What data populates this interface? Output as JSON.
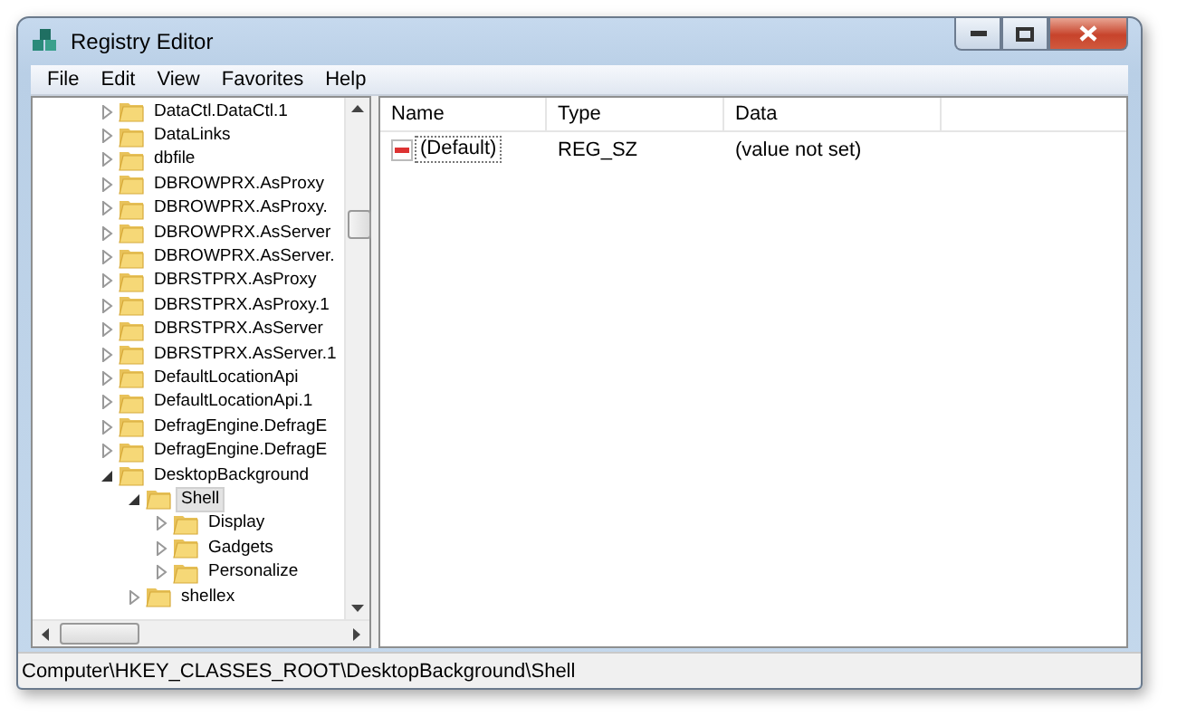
{
  "window": {
    "title": "Registry Editor"
  },
  "menu": [
    "File",
    "Edit",
    "View",
    "Favorites",
    "Help"
  ],
  "tree": [
    {
      "label": "DataCtl.DataCtl.1",
      "expanded": false,
      "selected": false
    },
    {
      "label": "DataLinks",
      "expanded": false,
      "selected": false
    },
    {
      "label": "dbfile",
      "expanded": false,
      "selected": false
    },
    {
      "label": "DBROWPRX.AsProxy",
      "expanded": false,
      "selected": false
    },
    {
      "label": "DBROWPRX.AsProxy.",
      "expanded": false,
      "selected": false
    },
    {
      "label": "DBROWPRX.AsServer",
      "expanded": false,
      "selected": false
    },
    {
      "label": "DBROWPRX.AsServer.",
      "expanded": false,
      "selected": false
    },
    {
      "label": "DBRSTPRX.AsProxy",
      "expanded": false,
      "selected": false
    },
    {
      "label": "DBRSTPRX.AsProxy.1",
      "expanded": false,
      "selected": false
    },
    {
      "label": "DBRSTPRX.AsServer",
      "expanded": false,
      "selected": false
    },
    {
      "label": "DBRSTPRX.AsServer.1",
      "expanded": false,
      "selected": false
    },
    {
      "label": "DefaultLocationApi",
      "expanded": false,
      "selected": false
    },
    {
      "label": "DefaultLocationApi.1",
      "expanded": false,
      "selected": false
    },
    {
      "label": "DefragEngine.DefragE",
      "expanded": false,
      "selected": false
    },
    {
      "label": "DefragEngine.DefragE",
      "expanded": false,
      "selected": false
    },
    {
      "label": "DesktopBackground",
      "expanded": true,
      "selected": false,
      "children": [
        {
          "label": "Shell",
          "expanded": true,
          "selected": true,
          "children": [
            {
              "label": "Display",
              "expanded": false,
              "selected": false
            },
            {
              "label": "Gadgets",
              "expanded": false,
              "selected": false
            },
            {
              "label": "Personalize",
              "expanded": false,
              "selected": false
            }
          ]
        },
        {
          "label": "shellex",
          "expanded": false,
          "selected": false
        }
      ]
    }
  ],
  "table": {
    "columns": [
      "Name",
      "Type",
      "Data"
    ],
    "rows": [
      {
        "name": "(Default)",
        "type": "REG_SZ",
        "data": "(value not set)",
        "selected": true
      }
    ]
  },
  "status_bar": "Computer\\HKEY_CLASSES_ROOT\\DesktopBackground\\Shell"
}
